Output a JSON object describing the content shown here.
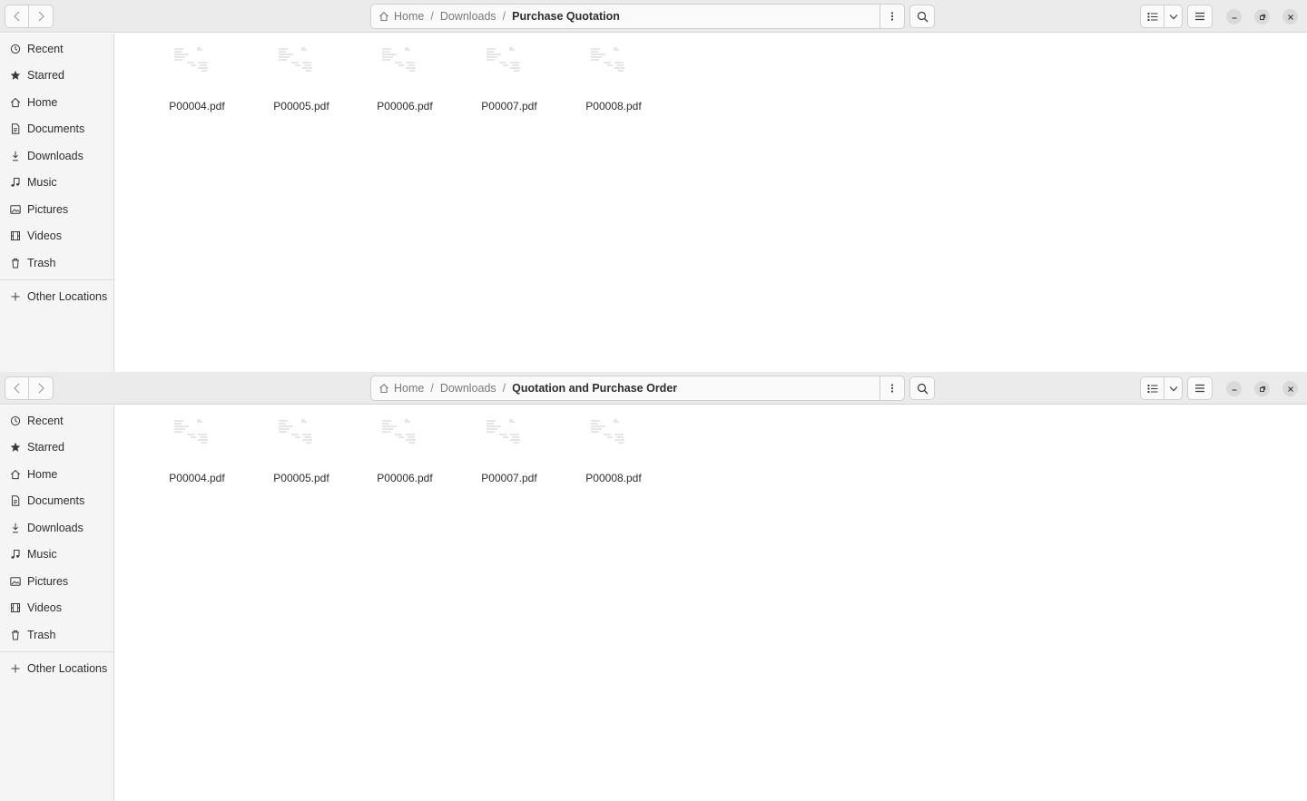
{
  "windows": [
    {
      "path": {
        "home": "Home",
        "downloads": "Downloads",
        "current": "Purchase Quotation"
      },
      "sidebar": [
        "Recent",
        "Starred",
        "Home",
        "Documents",
        "Downloads",
        "Music",
        "Pictures",
        "Videos",
        "Trash"
      ],
      "other_locations": "Other Locations",
      "files": [
        "P00004.pdf",
        "P00005.pdf",
        "P00006.pdf",
        "P00007.pdf",
        "P00008.pdf"
      ]
    },
    {
      "path": {
        "home": "Home",
        "downloads": "Downloads",
        "current": "Quotation and Purchase Order"
      },
      "sidebar": [
        "Recent",
        "Starred",
        "Home",
        "Documents",
        "Downloads",
        "Music",
        "Pictures",
        "Videos",
        "Trash"
      ],
      "other_locations": "Other Locations",
      "files": [
        "P00004.pdf",
        "P00005.pdf",
        "P00006.pdf",
        "P00007.pdf",
        "P00008.pdf"
      ]
    }
  ],
  "path_separator": "/",
  "icons": {
    "sidebar": [
      "clock-icon",
      "star-icon",
      "home-icon",
      "document-icon",
      "download-icon",
      "music-icon",
      "pictures-icon",
      "videos-icon",
      "trash-icon"
    ],
    "other_locations": "plus-icon"
  },
  "colors": {
    "headerbar": "#ebebeb",
    "sidebar": "#f5f5f5",
    "text": "#2e2e2e",
    "dim_text": "#7a7a7a"
  }
}
